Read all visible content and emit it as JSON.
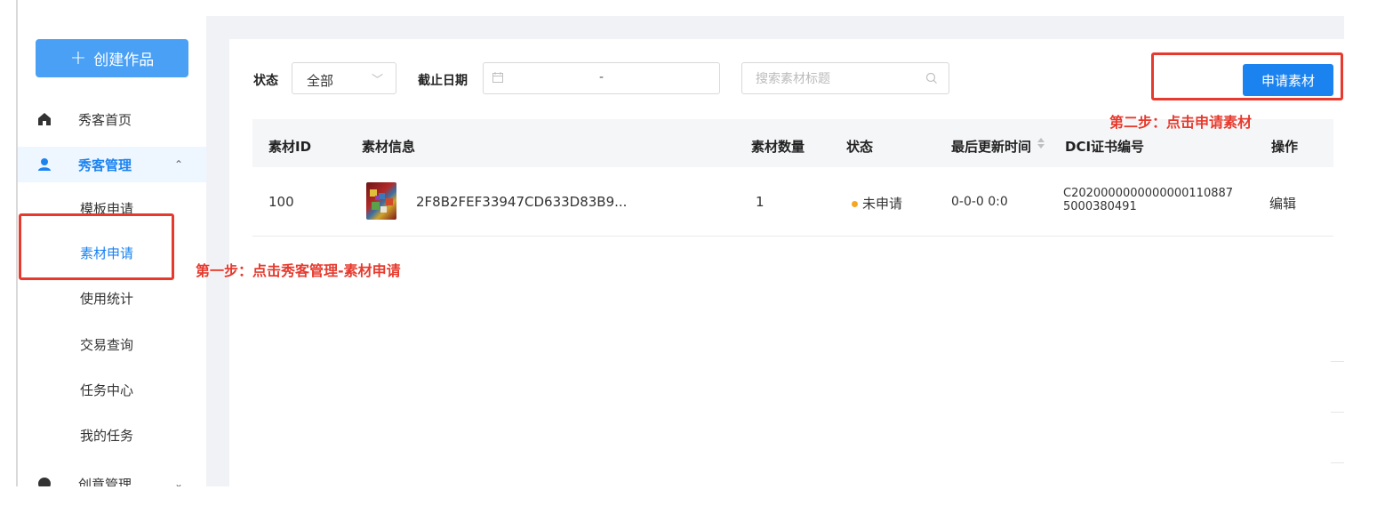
{
  "sidebar": {
    "create_button": "创建作品",
    "items": [
      {
        "label": "秀客首页",
        "icon": "home-icon"
      },
      {
        "label": "秀客管理",
        "icon": "user-icon",
        "expanded": true
      },
      {
        "label": "创意管理",
        "icon": "circle-icon"
      }
    ],
    "sub_items": [
      {
        "label": "模板申请"
      },
      {
        "label": "素材申请",
        "active": true
      },
      {
        "label": "使用统计"
      },
      {
        "label": "交易查询"
      },
      {
        "label": "任务中心"
      },
      {
        "label": "我的任务"
      }
    ]
  },
  "filters": {
    "status_label": "状态",
    "status_value": "全部",
    "date_label": "截止日期",
    "date_separator": "-",
    "search_placeholder": "搜索素材标题"
  },
  "apply_button": "申请素材",
  "table": {
    "headers": [
      "素材ID",
      "素材信息",
      "素材数量",
      "状态",
      "最后更新时间",
      "DCI证书编号",
      "操作"
    ],
    "rows": [
      {
        "id": "100",
        "info": "2F8B2FEF33947CD633D83B9...",
        "count": "1",
        "status": "未申请",
        "updated": "0-0-0 0:0",
        "dci_line1": "C2020000000000000110887",
        "dci_line2": "5000380491",
        "action": "编辑"
      }
    ]
  },
  "annotations": {
    "step1": "第一步：点击秀客管理-素材申请",
    "step2": "第二步：点击申请素材"
  },
  "colors": {
    "accent": "#1a83f0",
    "create_button": "#49a0f5",
    "annotation": "#e63a2e",
    "status_dot": "#f5a623"
  }
}
